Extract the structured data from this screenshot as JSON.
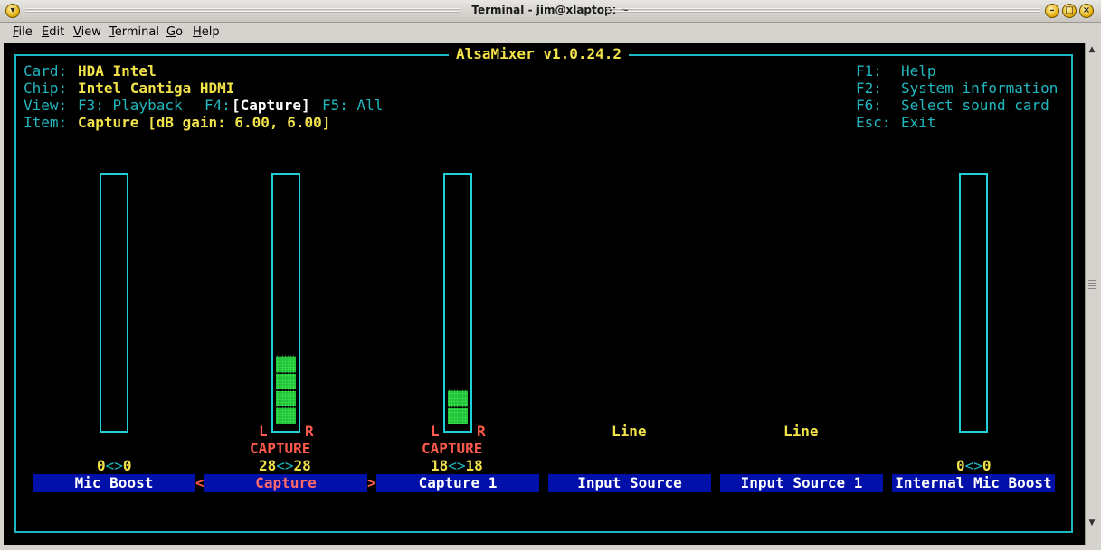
{
  "window": {
    "title": "Terminal - jim@xlaptop: ~"
  },
  "menu": {
    "items": [
      {
        "mnemonic": "F",
        "rest": "ile"
      },
      {
        "mnemonic": "E",
        "rest": "dit"
      },
      {
        "mnemonic": "V",
        "rest": "iew"
      },
      {
        "mnemonic": "T",
        "rest": "erminal"
      },
      {
        "mnemonic": "G",
        "rest": "o"
      },
      {
        "mnemonic": "H",
        "rest": "elp"
      }
    ]
  },
  "mixer": {
    "title": "AlsaMixer v1.0.24.2",
    "info": {
      "card_label": "Card:",
      "card_value": "HDA Intel",
      "chip_label": "Chip:",
      "chip_value": "Intel Cantiga HDMI",
      "view_label": "View:",
      "view_f3": "F3: Playback",
      "view_f4_key": "F4:",
      "view_f4_value": "[Capture]",
      "view_f5": "F5: All",
      "item_label": "Item:",
      "item_value": "Capture [dB gain: 6.00, 6.00]"
    },
    "keys": [
      {
        "key": "F1:",
        "desc": "Help"
      },
      {
        "key": "F2:",
        "desc": "System information"
      },
      {
        "key": "F6:",
        "desc": "Select sound card"
      },
      {
        "key": "Esc:",
        "desc": "Exit"
      }
    ],
    "controls": [
      {
        "name": "Mic Boost",
        "left_value": "0",
        "sep": "<>",
        "right_value": "0",
        "level": 0
      },
      {
        "name": "Capture",
        "left_value": "28",
        "sep": "<>",
        "right_value": "28",
        "capture_label": "CAPTURE",
        "l": "L",
        "r": "R",
        "level": 4,
        "selected": true
      },
      {
        "name": "Capture 1",
        "left_value": "18",
        "sep": "<>",
        "right_value": "18",
        "capture_label": "CAPTURE",
        "l": "L",
        "r": "R",
        "level": 2
      },
      {
        "name": "Input Source",
        "enum_value": "Line"
      },
      {
        "name": "Input Source 1",
        "enum_value": "Line"
      },
      {
        "name": "Internal Mic Boost",
        "left_value": "0",
        "sep": "<>",
        "right_value": "0",
        "level": 0
      }
    ],
    "selection_markers": {
      "left": "<",
      "right": ">"
    }
  }
}
